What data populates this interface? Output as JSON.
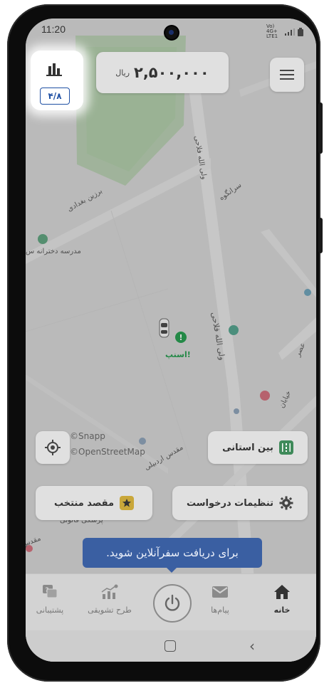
{
  "status": {
    "time": "11:20",
    "network": "Vo) 4G+ LTE1",
    "signal": "signal-icon",
    "battery": "battery-icon"
  },
  "header": {
    "balance_amount": "۲,۵۰۰,۰۰۰",
    "balance_currency": "ریال"
  },
  "rating": {
    "value": "۴/۸",
    "icon": "bar-chart-icon"
  },
  "map": {
    "streets": [
      "ولی الله فلاحی",
      "سرانگوه",
      "برزین بغدادی",
      "مقدس اردبیلی",
      "ولی الله فلاحی",
      "خیابان",
      "عصر",
      "پزشکی قانونی",
      "مقدس"
    ],
    "places": [
      "مدرسه دخترانه س",
      "اسنپ!"
    ],
    "attribution_1": "©Snapp",
    "attribution_2": "©OpenStreetMap"
  },
  "actions": {
    "intercity_label": "بین استانی",
    "settings_label": "تنظیمات درخواست",
    "favorite_label": "مقصد منتخب"
  },
  "tooltip": {
    "text": "برای دریافت سفرآنلاین شوید."
  },
  "nav": {
    "home": "خانه",
    "messages": "پیام‌ها",
    "incentive": "طرح تشویقی",
    "support": "پشتیبانی"
  },
  "colors": {
    "accent": "#3a5fa2",
    "snapp_green": "#1f9a4a",
    "badge_blue": "#1e4fa3"
  }
}
